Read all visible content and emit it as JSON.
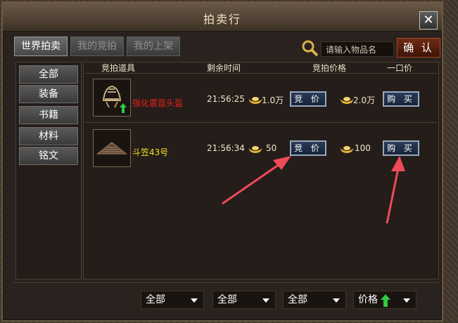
{
  "window": {
    "title": "拍卖行",
    "close_label": "✕"
  },
  "tabs": [
    {
      "label": "世界拍卖",
      "active": true
    },
    {
      "label": "我的竞拍",
      "active": false
    },
    {
      "label": "我的上架",
      "active": false
    }
  ],
  "search": {
    "placeholder": "请输入物品名",
    "confirm_label": "确 认"
  },
  "categories": [
    "全部",
    "装备",
    "书籍",
    "材料",
    "铭文"
  ],
  "columns": {
    "item": "竞拍道具",
    "time": "剩余时间",
    "bid_price": "竞拍价格",
    "buyout": "一口价"
  },
  "items": [
    {
      "name": "强化雷霆头盔",
      "name_color": "#e0201c",
      "time": "21:56:25",
      "bid": "1.0万",
      "bid_button": "竞 价",
      "buyout": "2.0万",
      "buy_button": "购 买"
    },
    {
      "name": "斗笠43号",
      "name_color": "#f0e020",
      "time": "21:56:34",
      "bid": "50",
      "bid_button": "竞 价",
      "buyout": "100",
      "buy_button": "购 买"
    }
  ],
  "filters": [
    "全部",
    "全部",
    "全部",
    "价格"
  ],
  "colors": {
    "accent_arrow": "#ef4a5a",
    "up_arrow": "#2ecc40"
  }
}
